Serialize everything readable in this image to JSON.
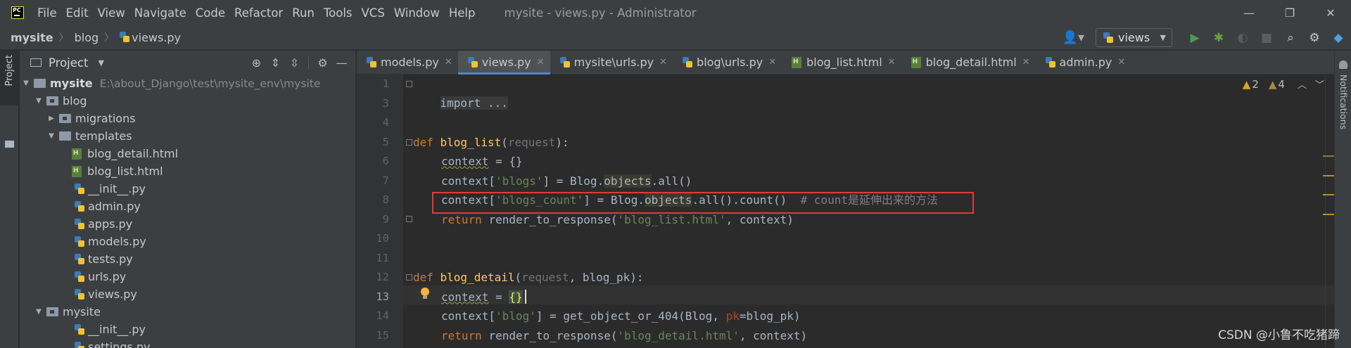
{
  "title_bar": {
    "menu": [
      "File",
      "Edit",
      "View",
      "Navigate",
      "Code",
      "Refactor",
      "Run",
      "Tools",
      "VCS",
      "Window",
      "Help"
    ],
    "window_title": "mysite - views.py - Administrator",
    "controls": {
      "minimize": "—",
      "restore": "❐",
      "close": "✕"
    }
  },
  "navbar": {
    "breadcrumb": [
      "mysite",
      "blog",
      "views.py"
    ],
    "run_config": "views"
  },
  "stripe": {
    "project_tab": "Project"
  },
  "project": {
    "title": "Project",
    "tree": [
      {
        "label": "mysite",
        "path": "E:\\about_Django\\test\\mysite_env\\mysite"
      },
      {
        "label": "blog"
      },
      {
        "label": "migrations"
      },
      {
        "label": "templates"
      },
      {
        "label": "blog_detail.html"
      },
      {
        "label": "blog_list.html"
      },
      {
        "label": "__init__.py"
      },
      {
        "label": "admin.py"
      },
      {
        "label": "apps.py"
      },
      {
        "label": "models.py"
      },
      {
        "label": "tests.py"
      },
      {
        "label": "urls.py"
      },
      {
        "label": "views.py"
      },
      {
        "label": "mysite"
      },
      {
        "label": "__init__.py"
      },
      {
        "label": "settings.py"
      }
    ]
  },
  "tabs": [
    {
      "label": "models.py"
    },
    {
      "label": "views.py"
    },
    {
      "label": "mysite\\urls.py"
    },
    {
      "label": "blog\\urls.py"
    },
    {
      "label": "blog_list.html"
    },
    {
      "label": "blog_detail.html"
    },
    {
      "label": "admin.py"
    }
  ],
  "editor": {
    "line_numbers": [
      "1",
      "3",
      "4",
      "5",
      "6",
      "7",
      "8",
      "9",
      "10",
      "11",
      "12",
      "13",
      "14",
      "15"
    ],
    "inspections": {
      "warnings": "2",
      "weak_warnings": "4"
    },
    "code": {
      "l1": "import ...",
      "l5_def": "def ",
      "l5_fn": "blog_list",
      "l5_p1": "(",
      "l5_param": "request",
      "l5_p2": "):",
      "l6_ctx": "context",
      "l6_rest": " = {}",
      "l7_a": "context[",
      "l7_str": "'blogs'",
      "l7_b": "] = Blog.",
      "l7_obj": "objects",
      "l7_c": ".all()",
      "l8_a": "context[",
      "l8_str": "'blogs_count'",
      "l8_b": "] = Blog.",
      "l8_obj": "objects",
      "l8_c": ".all().count()  ",
      "l8_cmt": "# count是延伸出来的方法",
      "l9_ret": "return ",
      "l9_a": "render_to_response(",
      "l9_str": "'blog_list.html'",
      "l9_b": ", context)",
      "l12_def": "def ",
      "l12_fn": "blog_detail",
      "l12_p1": "(",
      "l12_param": "request",
      "l12_p2": ", blog_pk):",
      "l13_ctx": "context",
      "l13_eq": " = ",
      "l13_brace": "{}",
      "l14_a": "context[",
      "l14_str": "'blog'",
      "l14_b": "] = get_object_or_404(Blog, ",
      "l14_kw": "pk",
      "l14_c": "=blog_pk)",
      "l15_ret": "return ",
      "l15_a": "render_to_response(",
      "l15_str": "'blog_detail.html'",
      "l15_b": ", context)"
    }
  },
  "right_stripe": {
    "notifications": "Notifications"
  },
  "watermark": "CSDN @小鲁不吃猪蹄"
}
